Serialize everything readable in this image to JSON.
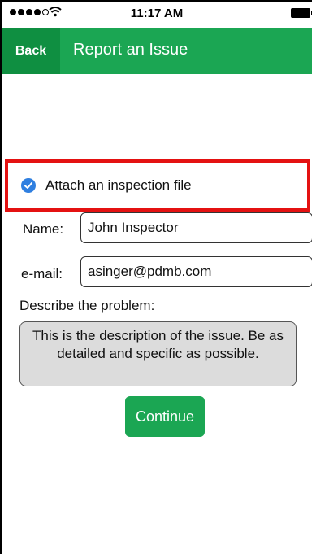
{
  "status_bar": {
    "time": "11:17 AM"
  },
  "nav": {
    "back_label": "Back",
    "title": "Report an Issue"
  },
  "attach": {
    "label": "Attach an inspection file",
    "checked": true
  },
  "form": {
    "name_label": "Name:",
    "name_value": "John Inspector",
    "email_label": "e-mail:",
    "email_value": "asinger@pdmb.com",
    "describe_label": "Describe the problem:",
    "description_text": "This is the description of the issue. Be as detailed and specific as possible."
  },
  "actions": {
    "continue_label": "Continue"
  },
  "colors": {
    "nav_green": "#1ba653",
    "back_green": "#0f8f41",
    "highlight_red": "#e41111",
    "check_blue": "#2f7fe0"
  }
}
